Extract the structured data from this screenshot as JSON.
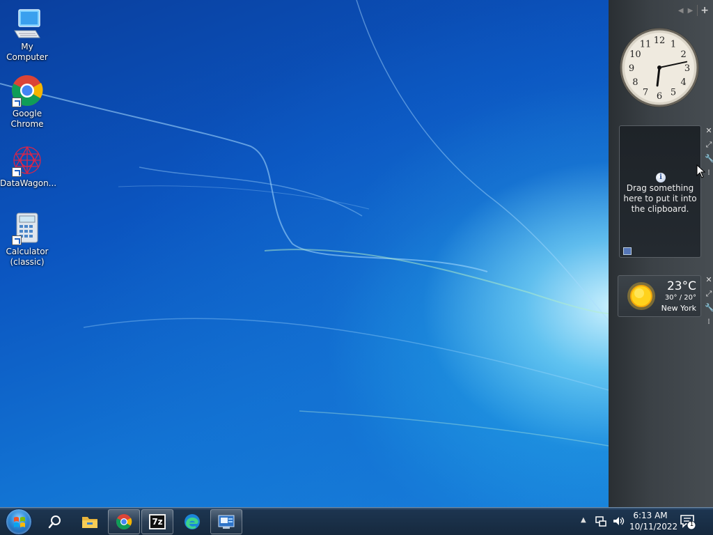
{
  "desktop_icons": [
    {
      "label": "My Computer",
      "icon": "computer-icon"
    },
    {
      "label": "Google Chrome",
      "icon": "chrome-icon"
    },
    {
      "label": "DataWagon...",
      "icon": "datawagon-icon"
    },
    {
      "label": "Calculator (classic)",
      "icon": "calculator-icon"
    }
  ],
  "sidebar": {
    "controls": {
      "prev": "◀",
      "next": "▶",
      "add": "+"
    }
  },
  "clock_gadget": {
    "numerals": [
      "1",
      "2",
      "3",
      "4",
      "5",
      "6",
      "7",
      "8",
      "9",
      "10",
      "11",
      "12"
    ],
    "time": {
      "hour": 6,
      "minute": 13
    }
  },
  "clipboard_gadget": {
    "info_icon": "i",
    "message": "Drag something here to put it into the clipboard."
  },
  "weather_gadget": {
    "temperature": "23°C",
    "range": "30° / 20°",
    "city": "New York",
    "condition_icon": "sun-icon"
  },
  "taskbar": {
    "pinned": [
      "search-icon",
      "file-explorer-icon",
      "chrome-icon",
      "7zip-icon",
      "edge-icon",
      "remote-desktop-icon"
    ],
    "seven_zip_label": "7z",
    "tray": {
      "time": "6:13 AM",
      "date": "10/11/2022",
      "notification_count": "1"
    }
  },
  "colors": {
    "wallpaper_base": "#0b55c0",
    "taskbar_bg": "#16293e",
    "sidebar_bg": "#3b4146"
  }
}
